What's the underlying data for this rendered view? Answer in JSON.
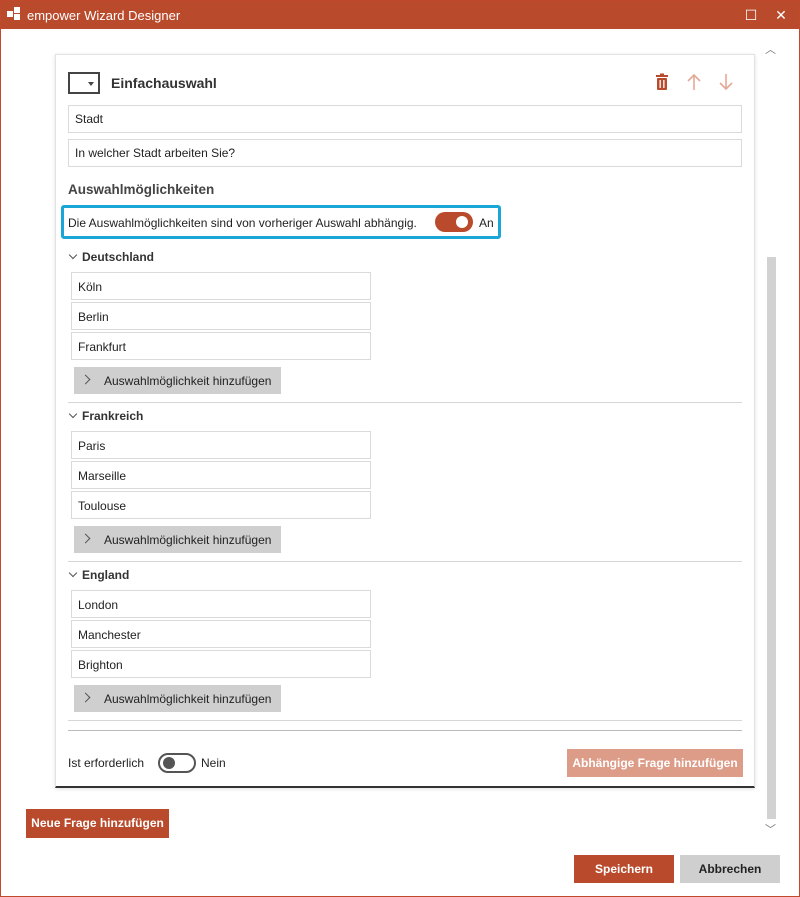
{
  "window": {
    "title": "empower Wizard Designer",
    "maximize_label": "☐",
    "close_label": "✕"
  },
  "colors": {
    "accent": "#b94a2c",
    "highlight": "#1aa6d6",
    "disabled_accent": "#dd9c88",
    "neutral_button": "#cfcfcf"
  },
  "question": {
    "type_label": "Einfachauswahl",
    "name_value": "Stadt",
    "text_value": "In welcher Stadt arbeiten Sie?",
    "actions": {
      "delete_icon": "trash-icon",
      "up_icon": "arrow-up-icon",
      "down_icon": "arrow-down-icon"
    }
  },
  "options_section": {
    "title": "Auswahlmöglichkeiten",
    "dependent_label": "Die Auswahlmöglichkeiten sind von vorheriger Auswahl abhängig.",
    "dependent_state": "An",
    "add_option_label": "Auswahlmöglichkeit hinzufügen",
    "groups": [
      {
        "name": "Deutschland",
        "options": [
          "Köln",
          "Berlin",
          "Frankfurt"
        ]
      },
      {
        "name": "Frankreich",
        "options": [
          "Paris",
          "Marseille",
          "Toulouse"
        ]
      },
      {
        "name": "England",
        "options": [
          "London",
          "Manchester",
          "Brighton"
        ]
      }
    ]
  },
  "required": {
    "label": "Ist erforderlich",
    "state": "Nein"
  },
  "buttons": {
    "dependent_question": "Abhängige Frage hinzufügen",
    "new_question": "Neue Frage hinzufügen",
    "save": "Speichern",
    "cancel": "Abbrechen"
  }
}
